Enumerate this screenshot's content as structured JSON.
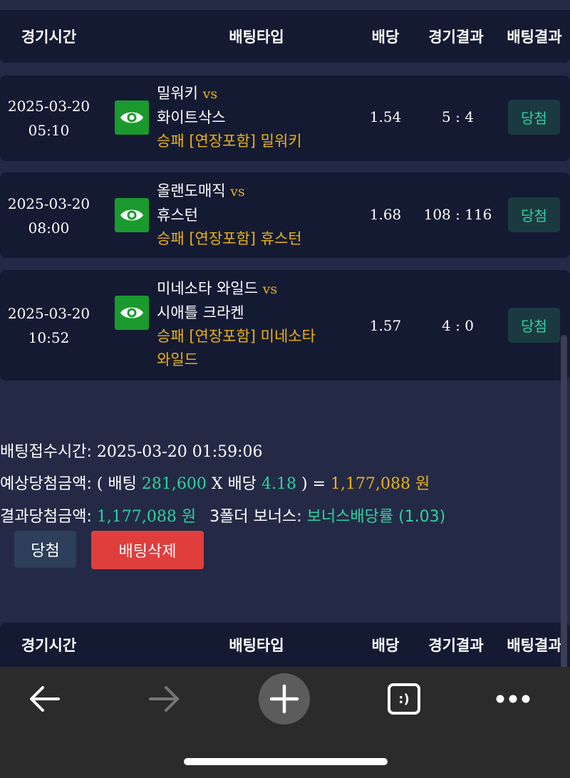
{
  "table_header": {
    "time": "경기시간",
    "bet_type": "배팅타입",
    "odds": "배당",
    "match_result": "경기결과",
    "bet_result": "배팅결과"
  },
  "bets": [
    {
      "date": "2025-03-20",
      "time": "05:10",
      "home": "밀워키",
      "vs": "vs",
      "away": "화이트삭스",
      "pick": "승패 [연장포함] 밀워키",
      "odds": "1.54",
      "score": "5 : 4",
      "result": "당첨"
    },
    {
      "date": "2025-03-20",
      "time": "08:00",
      "home": "올랜도매직",
      "vs": "vs",
      "away": "휴스턴",
      "pick": "승패 [연장포함] 휴스턴",
      "odds": "1.68",
      "score": "108 : 116",
      "result": "당첨"
    },
    {
      "date": "2025-03-20",
      "time": "10:52",
      "home": "미네소타 와일드",
      "vs": "vs",
      "away": "시애틀 크라켄",
      "pick_line1": "승패 [연장포함] 미네소타",
      "pick_line2": "와일드",
      "odds": "1.57",
      "score": "4 : 0",
      "result": "당첨"
    }
  ],
  "summary": {
    "received_label": "배팅접수시간:",
    "received_value": "2025-03-20 01:59:06",
    "expected_label": "예상당첨금액:",
    "expected_open": "( 배팅",
    "stake": "281,600",
    "x_odds": "X 배당",
    "total_odds": "4.18",
    "expected_close": ") =",
    "expected_amount": "1,177,088 원",
    "result_label": "결과당첨금액:",
    "result_amount": "1,177,088 원",
    "bonus_label": "3폴더 보너스:",
    "bonus_value": "보너스배당률 (1.03)"
  },
  "buttons": {
    "win": "당첨",
    "delete": "배팅삭제"
  },
  "browser": {
    "tabs_label": ":)"
  },
  "icons": {
    "view": "eye-icon",
    "back": "arrow-left-icon",
    "forward": "arrow-right-icon",
    "new_tab": "plus-icon",
    "tabs": "tabs-icon",
    "menu": "more-icon"
  },
  "colors": {
    "background": "#242a45",
    "row": "#151a33",
    "gold": "#e8b319",
    "green": "#2fd2a0",
    "eye_button": "#1a9a2e",
    "delete_button": "#e03d3d"
  }
}
